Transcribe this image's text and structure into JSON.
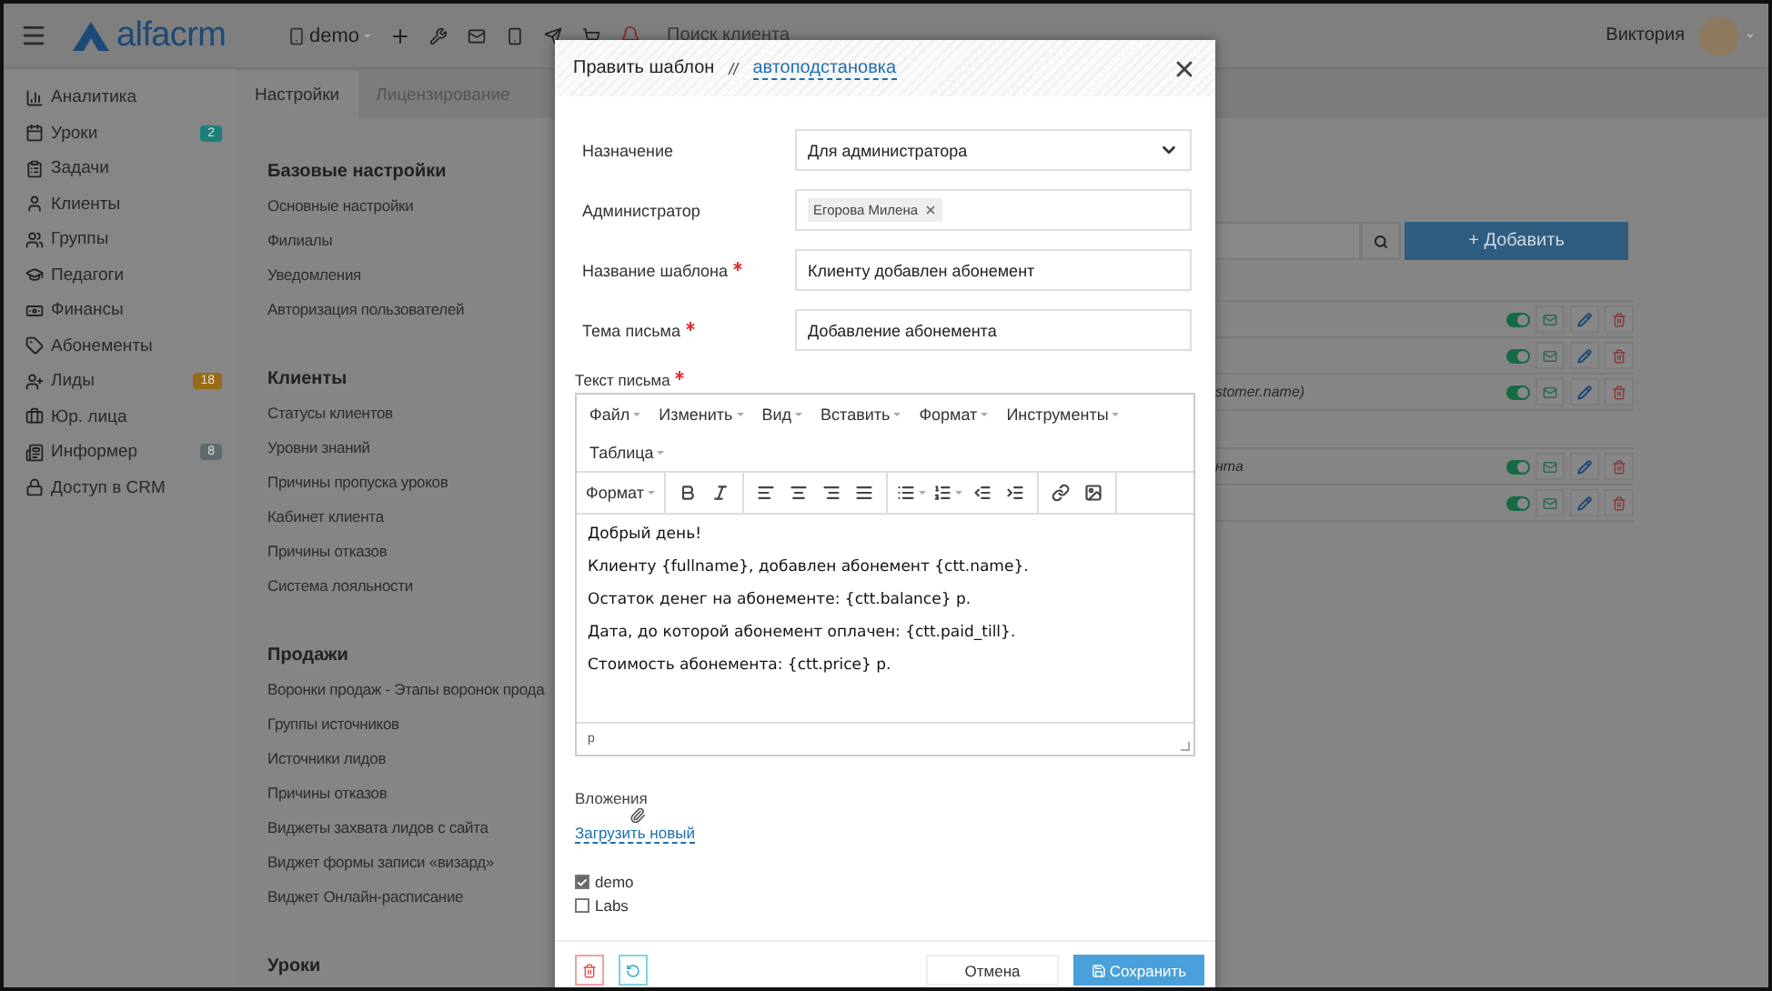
{
  "topbar": {
    "logo": "alfacrm",
    "branch": "demo",
    "search_placeholder": "Поиск клиента",
    "user": "Виктория"
  },
  "sidebar": {
    "items": [
      {
        "label": "Аналитика"
      },
      {
        "label": "Уроки",
        "badge": "2",
        "color": "#1e7f7a"
      },
      {
        "label": "Задачи"
      },
      {
        "label": "Клиенты"
      },
      {
        "label": "Группы"
      },
      {
        "label": "Педагоги"
      },
      {
        "label": "Финансы"
      },
      {
        "label": "Абонементы"
      },
      {
        "label": "Лиды",
        "badge": "18",
        "color": "#9a6a18"
      },
      {
        "label": "Юр. лица"
      },
      {
        "label": "Информер",
        "badge": "8",
        "color": "#5e6a6e"
      },
      {
        "label": "Доступ в CRM"
      }
    ]
  },
  "settings": {
    "tabs": [
      {
        "label": "Настройки",
        "selected": true
      },
      {
        "label": "Лицензирование",
        "selected": false
      }
    ],
    "sections": [
      {
        "title": "Базовые настройки",
        "items": [
          "Основные настройки",
          "Филиалы",
          "Уведомления",
          "Авторизация пользователей"
        ]
      },
      {
        "title": "Клиенты",
        "items": [
          "Статусы клиентов",
          "Уровни знаний",
          "Причины пропуска уроков",
          "Кабинет клиента",
          "Причины отказов",
          "Система лояльности"
        ]
      },
      {
        "title": "Продажи",
        "items": [
          "Воронки продаж - Этапы воронок прода",
          "Группы источников",
          "Источники лидов",
          "Причины отказов",
          "Виджеты захвата лидов с сайта",
          "Виджет формы записи «визард»",
          "Виджет Онлайн-расписание"
        ]
      },
      {
        "title": "Уроки"
      }
    ]
  },
  "templates": {
    "add_button": "+ Добавить",
    "groups": [
      {
        "rows": [
          {
            "on": true
          },
          {
            "on": true
          },
          {
            "text": "stomer.name)",
            "on": true
          }
        ]
      },
      {
        "rows": [
          {
            "text": "нта",
            "on": true
          },
          {
            "on": true
          }
        ]
      }
    ]
  },
  "modal": {
    "title": "Править шаблон",
    "separator": "//",
    "link": "автоподстановка",
    "fields": [
      {
        "kind": "select",
        "label": "Назначение",
        "required": false,
        "value": "Для администратора"
      },
      {
        "kind": "tags",
        "label": "Администратор",
        "required": false,
        "tags": [
          "Егорова Милена"
        ]
      },
      {
        "kind": "text",
        "label": "Название шаблона",
        "required": true,
        "value": "Клиенту добавлен абонемент"
      },
      {
        "kind": "text",
        "label": "Тема письма",
        "required": true,
        "value": "Добавление абонемента"
      }
    ],
    "editor": {
      "label": "Текст письма",
      "required": true,
      "menu": [
        "Файл",
        "Изменить",
        "Вид",
        "Вставить",
        "Формат",
        "Инструменты",
        "Таблица"
      ],
      "format": "Формат",
      "paragraphs": [
        "Добрый день!",
        "Клиенту {fullname}, добавлен абонемент {ctt.name}.",
        "Остаток денег на абонементе: {ctt.balance} р.",
        "Дата, до которой абонемент оплачен: {ctt.paid_till}.",
        "Стоимость абонемента: {ctt.price} р."
      ],
      "status": "p"
    },
    "attachments": {
      "label": "Вложения",
      "upload": "Загрузить новый"
    },
    "branches": [
      {
        "label": "demo",
        "checked": true
      },
      {
        "label": "Labs",
        "checked": false
      }
    ],
    "cancel": "Отмена",
    "save": "Сохранить"
  }
}
